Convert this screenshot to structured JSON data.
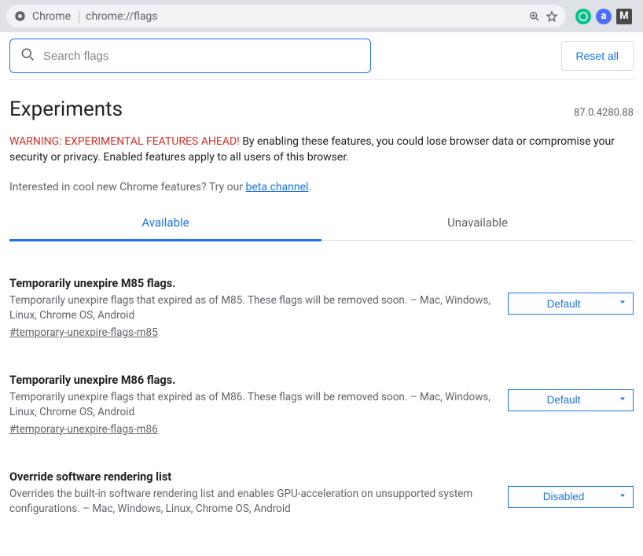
{
  "addressbar": {
    "app_label": "Chrome",
    "url": "chrome://flags"
  },
  "topbar": {
    "search_placeholder": "Search flags",
    "reset_label": "Reset all"
  },
  "header": {
    "title": "Experiments",
    "version": "87.0.4280.88"
  },
  "warn": {
    "red": "WARNING: EXPERIMENTAL FEATURES AHEAD!",
    "rest": " By enabling these features, you could lose browser data or compromise your security or privacy. Enabled features apply to all users of this browser."
  },
  "beta": {
    "pre": "Interested in cool new Chrome features? Try our ",
    "link": "beta channel",
    "post": "."
  },
  "tabs": {
    "available": "Available",
    "unavailable": "Unavailable"
  },
  "flags": [
    {
      "title": "Temporarily unexpire M85 flags.",
      "desc": "Temporarily unexpire flags that expired as of M85. These flags will be removed soon. – Mac, Windows, Linux, Chrome OS, Android",
      "hash": "#temporary-unexpire-flags-m85",
      "value": "Default"
    },
    {
      "title": "Temporarily unexpire M86 flags.",
      "desc": "Temporarily unexpire flags that expired as of M86. These flags will be removed soon. – Mac, Windows, Linux, Chrome OS, Android",
      "hash": "#temporary-unexpire-flags-m86",
      "value": "Default"
    },
    {
      "title": "Override software rendering list",
      "desc": "Overrides the built-in software rendering list and enables GPU-acceleration on unsupported system configurations. – Mac, Windows, Linux, Chrome OS, Android",
      "hash": "",
      "value": "Disabled"
    }
  ]
}
